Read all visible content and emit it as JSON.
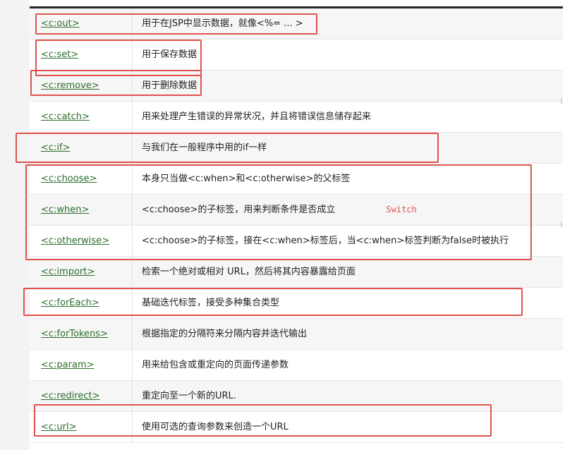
{
  "rows": [
    {
      "tag": "<c:out>",
      "description": "用于在JSP中显示数据，就像<%= ... >"
    },
    {
      "tag": "<c:set>",
      "description": "用于保存数据"
    },
    {
      "tag": "<c:remove>",
      "description": "用于删除数据"
    },
    {
      "tag": "<c:catch>",
      "description": "用来处理产生错误的异常状况，并且将错误信息储存起来"
    },
    {
      "tag": "<c:if>",
      "description": "与我们在一般程序中用的if一样"
    },
    {
      "tag": "<c:choose>",
      "description": "本身只当做<c:when>和<c:otherwise>的父标签"
    },
    {
      "tag": "<c:when>",
      "description": "<c:choose>的子标签，用来判断条件是否成立",
      "note": "Switch"
    },
    {
      "tag": "<c:otherwise>",
      "description": "<c:choose>的子标签，接在<c:when>标签后，当<c:when>标签判断为false时被执行"
    },
    {
      "tag": "<c:import>",
      "description": "检索一个绝对或相对 URL，然后将其内容暴露给页面"
    },
    {
      "tag": "<c:forEach>",
      "description": "基础迭代标签，接受多种集合类型"
    },
    {
      "tag": "<c:forTokens>",
      "description": "根据指定的分隔符来分隔内容并迭代输出"
    },
    {
      "tag": "<c:param>",
      "description": "用来给包含或重定向的页面传递参数"
    },
    {
      "tag": "<c:redirect>",
      "description": "重定向至一个新的URL."
    },
    {
      "tag": "<c:url>",
      "description": "使用可选的查询参数来创造一个URL"
    }
  ],
  "colors": {
    "link": "#2c6e2c",
    "highlight_box": "#e0524d",
    "note_text": "#e05252",
    "row_alt": "#f6f6f6"
  }
}
